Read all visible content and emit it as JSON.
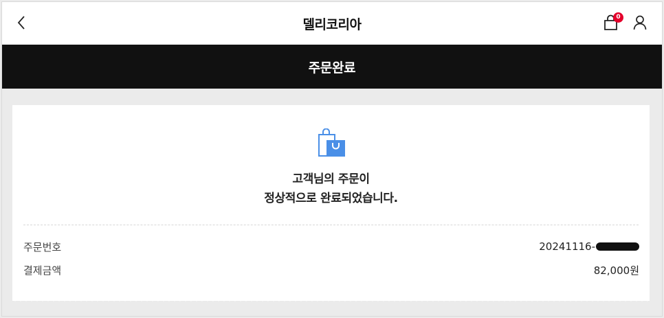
{
  "topbar": {
    "title": "델리코리아",
    "back_icon": "chevron-left-icon",
    "cart_icon": "shopping-bag-icon",
    "cart_count": "0",
    "user_icon": "user-icon"
  },
  "header": {
    "title": "주문완료"
  },
  "completion": {
    "icon": "shopping-bag-check-icon",
    "line1": "고객님의 주문이",
    "line2": "정상적으로 완료되었습니다."
  },
  "order": {
    "number_label": "주문번호",
    "number_value": "20241116-",
    "amount_label": "결제금액",
    "amount_value": "82,000원"
  },
  "colors": {
    "accent": "#e4002b",
    "icon_blue": "#4a8fe7",
    "header_bg": "#111111"
  }
}
